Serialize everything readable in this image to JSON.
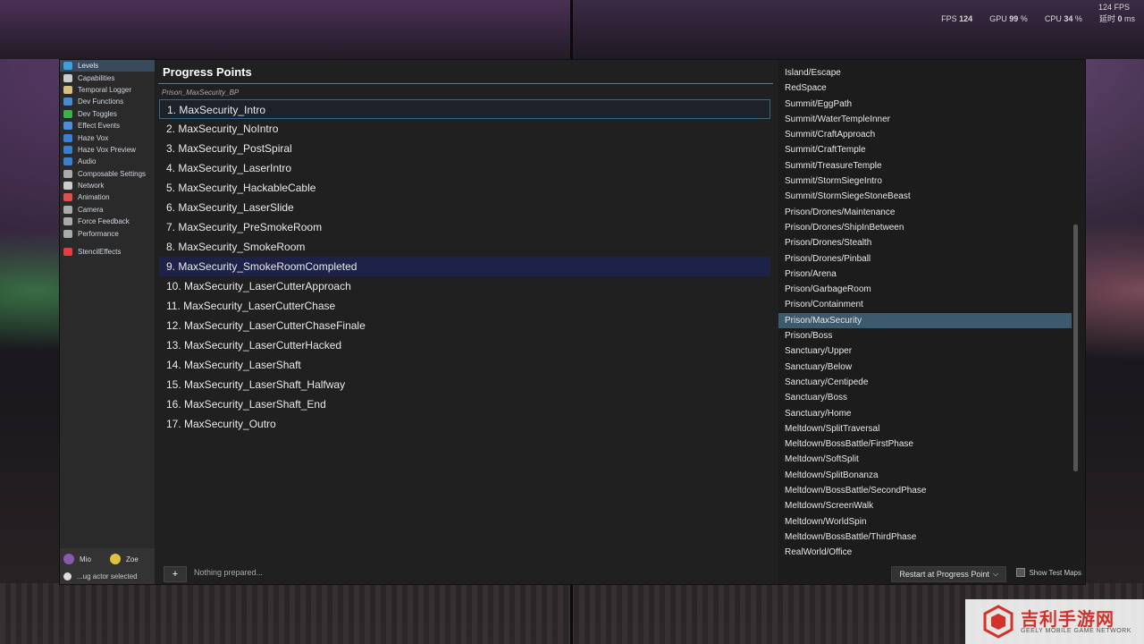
{
  "stats": {
    "fps_top": "124 FPS",
    "fps_label": "FPS",
    "fps_value": "124",
    "gpu_label": "GPU",
    "gpu_value": "99",
    "cpu_label": "CPU",
    "cpu_value": "34",
    "percent": "%",
    "latency_label": "延时",
    "latency_value": "0",
    "latency_unit": "ms"
  },
  "menu": [
    {
      "label": "Levels",
      "icon": "globe-icon",
      "active": true,
      "color": "#3aa0e0"
    },
    {
      "label": "Capabilities",
      "icon": "glasses-icon",
      "active": false,
      "color": "#cccccc"
    },
    {
      "label": "Temporal Logger",
      "icon": "hourglass-icon",
      "active": false,
      "color": "#d8c080"
    },
    {
      "label": "Dev Functions",
      "icon": "puzzle-icon",
      "active": false,
      "color": "#4a8ad0"
    },
    {
      "label": "Dev Toggles",
      "icon": "check-icon",
      "active": false,
      "color": "#3cb04a"
    },
    {
      "label": "Effect Events",
      "icon": "spark-icon",
      "active": false,
      "color": "#4a90d8"
    },
    {
      "label": "Haze Vox",
      "icon": "voxel-icon",
      "active": false,
      "color": "#3a80d0"
    },
    {
      "label": "Haze Vox Preview",
      "icon": "voxel-preview-icon",
      "active": false,
      "color": "#3a80d0"
    },
    {
      "label": "Audio",
      "icon": "audio-icon",
      "active": false,
      "color": "#3a80d0"
    },
    {
      "label": "Composable Settings",
      "icon": "gear-icon",
      "active": false,
      "color": "#aaaaaa"
    },
    {
      "label": "Network",
      "icon": "network-icon",
      "active": false,
      "color": "#cccccc"
    },
    {
      "label": "Animation",
      "icon": "running-icon",
      "active": false,
      "color": "#e05050"
    },
    {
      "label": "Camera",
      "icon": "camera-icon",
      "active": false,
      "color": "#aaaaaa"
    },
    {
      "label": "Force Feedback",
      "icon": "gamepad-icon",
      "active": false,
      "color": "#aaaaaa"
    },
    {
      "label": "Performance",
      "icon": "performance-icon",
      "active": false,
      "color": "#aaaaaa"
    },
    {
      "label": "StencilEffects",
      "icon": "stencil-icon",
      "active": false,
      "color": "#e04040",
      "gap": true
    }
  ],
  "players": {
    "p1": "Mio",
    "p2": "Zoe",
    "actor": "...ug actor selected"
  },
  "center": {
    "title": "Progress Points",
    "sublabel": "Prison_MaxSecurity_BP",
    "points": [
      "1. MaxSecurity_Intro",
      "2. MaxSecurity_NoIntro",
      "3. MaxSecurity_PostSpiral",
      "4. MaxSecurity_LaserIntro",
      "5. MaxSecurity_HackableCable",
      "6. MaxSecurity_LaserSlide",
      "7. MaxSecurity_PreSmokeRoom",
      "8. MaxSecurity_SmokeRoom",
      "9. MaxSecurity_SmokeRoomCompleted",
      "10. MaxSecurity_LaserCutterApproach",
      "11. MaxSecurity_LaserCutterChase",
      "12. MaxSecurity_LaserCutterChaseFinale",
      "13. MaxSecurity_LaserCutterHacked",
      "14. MaxSecurity_LaserShaft",
      "15. MaxSecurity_LaserShaft_Halfway",
      "16. MaxSecurity_LaserShaft_End",
      "17. MaxSecurity_Outro"
    ],
    "plus_label": "+",
    "status": "Nothing prepared..."
  },
  "maps": {
    "items": [
      "Island/Escape",
      "RedSpace",
      "Summit/EggPath",
      "Summit/WaterTempleInner",
      "Summit/CraftApproach",
      "Summit/CraftTemple",
      "Summit/TreasureTemple",
      "Summit/StormSiegeIntro",
      "Summit/StormSiegeStoneBeast",
      "Prison/Drones/Maintenance",
      "Prison/Drones/ShipInBetween",
      "Prison/Drones/Stealth",
      "Prison/Drones/Pinball",
      "Prison/Arena",
      "Prison/GarbageRoom",
      "Prison/Containment",
      "Prison/MaxSecurity",
      "Prison/Boss",
      "Sanctuary/Upper",
      "Sanctuary/Below",
      "Sanctuary/Centipede",
      "Sanctuary/Boss",
      "Sanctuary/Home",
      "Meltdown/SplitTraversal",
      "Meltdown/BossBattle/FirstPhase",
      "Meltdown/SoftSplit",
      "Meltdown/SplitBonanza",
      "Meltdown/BossBattle/SecondPhase",
      "Meltdown/ScreenWalk",
      "Meltdown/WorldSpin",
      "Meltdown/BossBattle/ThirdPhase",
      "RealWorld/Office"
    ],
    "selected": "Prison/MaxSecurity",
    "restart_label": "Restart at Progress Point",
    "show_test_label": "Show Test Maps"
  },
  "watermark": {
    "title": "吉利手游网",
    "sub": "GEELY MOBILE GAME NETWORK"
  }
}
